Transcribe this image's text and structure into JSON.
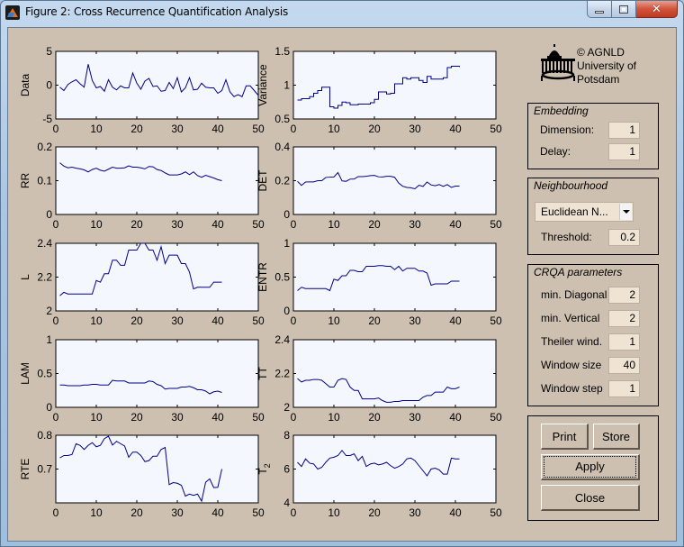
{
  "window": {
    "title": "Figure 2: Cross Recurrence Quantification Analysis",
    "controls": [
      "minimize",
      "maximize",
      "close"
    ]
  },
  "credit": {
    "line1": "© AGNLD",
    "line2": "University of",
    "line3": "Potsdam"
  },
  "embedding": {
    "title": "Embedding",
    "dimension_label": "Dimension:",
    "dimension_value": "1",
    "delay_label": "Delay:",
    "delay_value": "1"
  },
  "neighbourhood": {
    "title": "Neighbourhood",
    "norm_selected": "Euclidean N...",
    "threshold_label": "Threshold:",
    "threshold_value": "0.2"
  },
  "crqa": {
    "title": "CRQA parameters",
    "params": [
      {
        "label": "min. Diagonal",
        "value": "2"
      },
      {
        "label": "min. Vertical",
        "value": "2"
      },
      {
        "label": "Theiler wind.",
        "value": "1"
      },
      {
        "label": "Window size",
        "value": "40"
      },
      {
        "label": "Window step",
        "value": "1"
      }
    ]
  },
  "buttons": {
    "print": "Print",
    "store": "Store",
    "apply": "Apply",
    "close": "Close"
  },
  "colors": {
    "line": "#00008b",
    "axes_bg": "#f5f7fe",
    "figure_bg": "#cdc0b1"
  },
  "chart_data": [
    {
      "type": "line",
      "ylabel": "Data",
      "xlim": [
        0,
        50
      ],
      "ylim": [
        -5,
        5
      ],
      "xticks": [
        "0",
        "10",
        "20",
        "30",
        "40",
        "50"
      ],
      "yticks": [
        "-5",
        "0",
        "5"
      ],
      "ytick_values": [
        -5,
        0,
        5
      ],
      "x": [
        1,
        2,
        3,
        4,
        5,
        6,
        7,
        8,
        9,
        10,
        11,
        12,
        13,
        14,
        15,
        16,
        17,
        18,
        19,
        20,
        21,
        22,
        23,
        24,
        25,
        26,
        27,
        28,
        29,
        30,
        31,
        32,
        33,
        34,
        35,
        36,
        37,
        38,
        39,
        40,
        41,
        42,
        43,
        44,
        45,
        46,
        47,
        48,
        49,
        50
      ],
      "y": [
        -0.3,
        -0.8,
        0.1,
        0.5,
        0.8,
        0.2,
        -0.3,
        3.1,
        0.7,
        -0.4,
        -0.2,
        -0.9,
        0.8,
        -0.3,
        -0.7,
        -0.1,
        -0.4,
        -0.4,
        1.8,
        0.3,
        -0.6,
        0.6,
        1.0,
        -0.2,
        -0.1,
        -0.9,
        -0.8,
        0.4,
        -0.5,
        1.1,
        -1.0,
        -0.4,
        1.1,
        -0.7,
        -0.6,
        0.3,
        -0.3,
        -0.4,
        -0.4,
        -1.2,
        -0.8,
        0.8,
        -1.0,
        -1.7,
        -1.4,
        -1.7,
        -0.1,
        -0.1,
        -0.8,
        -1.5
      ]
    },
    {
      "type": "line",
      "step": true,
      "ylabel": "Variance",
      "xlim": [
        0,
        50
      ],
      "ylim": [
        0.5,
        1.5
      ],
      "xticks": [
        "0",
        "10",
        "20",
        "30",
        "40",
        "50"
      ],
      "yticks": [
        "0.5",
        "1",
        "1.5"
      ],
      "ytick_values": [
        0.5,
        1,
        1.5
      ],
      "x": [
        1,
        2,
        3,
        4,
        5,
        6,
        7,
        8,
        9,
        10,
        11,
        12,
        13,
        14,
        15,
        16,
        17,
        18,
        19,
        20,
        21,
        22,
        23,
        24,
        25,
        26,
        27,
        28,
        29,
        30,
        31,
        32,
        33,
        34,
        35,
        36,
        37,
        38,
        39,
        40,
        41
      ],
      "y": [
        0.78,
        0.8,
        0.8,
        0.83,
        0.88,
        0.92,
        0.97,
        0.97,
        0.68,
        0.66,
        0.7,
        0.75,
        0.74,
        0.71,
        0.71,
        0.72,
        0.72,
        0.72,
        0.74,
        0.79,
        0.9,
        0.9,
        0.87,
        0.88,
        1.02,
        1.02,
        1.11,
        1.09,
        1.11,
        1.11,
        1.07,
        1.04,
        1.13,
        1.09,
        1.09,
        1.09,
        1.11,
        1.26,
        1.28,
        1.28,
        1.27
      ]
    },
    {
      "type": "line",
      "ylabel": "RR",
      "xlim": [
        0,
        50
      ],
      "ylim": [
        0,
        0.2
      ],
      "xticks": [
        "0",
        "10",
        "20",
        "30",
        "40",
        "50"
      ],
      "yticks": [
        "0",
        "0.1",
        "0.2"
      ],
      "ytick_values": [
        0,
        0.1,
        0.2
      ],
      "x": [
        1,
        2,
        3,
        4,
        5,
        6,
        7,
        8,
        9,
        10,
        11,
        12,
        13,
        14,
        15,
        16,
        17,
        18,
        19,
        20,
        21,
        22,
        23,
        24,
        25,
        26,
        27,
        28,
        29,
        30,
        31,
        32,
        33,
        34,
        35,
        36,
        37,
        38,
        39,
        40,
        41
      ],
      "y": [
        0.153,
        0.143,
        0.138,
        0.14,
        0.137,
        0.135,
        0.132,
        0.126,
        0.133,
        0.137,
        0.131,
        0.128,
        0.134,
        0.14,
        0.137,
        0.137,
        0.138,
        0.144,
        0.14,
        0.14,
        0.138,
        0.135,
        0.142,
        0.141,
        0.133,
        0.13,
        0.123,
        0.117,
        0.117,
        0.117,
        0.12,
        0.126,
        0.118,
        0.126,
        0.115,
        0.11,
        0.116,
        0.112,
        0.108,
        0.103,
        0.1
      ]
    },
    {
      "type": "line",
      "ylabel": "DET",
      "xlim": [
        0,
        50
      ],
      "ylim": [
        0,
        0.4
      ],
      "xticks": [
        "0",
        "10",
        "20",
        "30",
        "40",
        "50"
      ],
      "yticks": [
        "0",
        "0.2",
        "0.4"
      ],
      "ytick_values": [
        0,
        0.2,
        0.4
      ],
      "x": [
        1,
        2,
        3,
        4,
        5,
        6,
        7,
        8,
        9,
        10,
        11,
        12,
        13,
        14,
        15,
        16,
        17,
        18,
        19,
        20,
        21,
        22,
        23,
        24,
        25,
        26,
        27,
        28,
        29,
        30,
        31,
        32,
        33,
        34,
        35,
        36,
        37,
        38,
        39,
        40,
        41
      ],
      "y": [
        0.196,
        0.172,
        0.192,
        0.193,
        0.193,
        0.2,
        0.2,
        0.219,
        0.221,
        0.222,
        0.248,
        0.199,
        0.196,
        0.209,
        0.21,
        0.224,
        0.224,
        0.226,
        0.23,
        0.231,
        0.223,
        0.222,
        0.226,
        0.226,
        0.22,
        0.186,
        0.167,
        0.16,
        0.158,
        0.152,
        0.173,
        0.166,
        0.192,
        0.175,
        0.17,
        0.177,
        0.166,
        0.177,
        0.16,
        0.168,
        0.168
      ]
    },
    {
      "type": "line",
      "ylabel": "L",
      "xlim": [
        0,
        50
      ],
      "ylim": [
        2,
        2.4
      ],
      "xticks": [
        "0",
        "10",
        "20",
        "30",
        "40",
        "50"
      ],
      "yticks": [
        "2",
        "2.2",
        "2.4"
      ],
      "ytick_values": [
        2,
        2.2,
        2.4
      ],
      "x": [
        1,
        2,
        3,
        4,
        5,
        6,
        7,
        8,
        9,
        10,
        11,
        12,
        13,
        14,
        15,
        16,
        17,
        18,
        19,
        20,
        21,
        22,
        23,
        24,
        25,
        26,
        27,
        28,
        29,
        30,
        31,
        32,
        33,
        34,
        35,
        36,
        37,
        38,
        39,
        40,
        41
      ],
      "y": [
        2.09,
        2.11,
        2.1,
        2.1,
        2.1,
        2.1,
        2.1,
        2.1,
        2.1,
        2.18,
        2.17,
        2.22,
        2.22,
        2.3,
        2.3,
        2.27,
        2.27,
        2.36,
        2.36,
        2.36,
        2.4,
        2.4,
        2.36,
        2.36,
        2.3,
        2.38,
        2.28,
        2.33,
        2.33,
        2.33,
        2.28,
        2.28,
        2.23,
        2.13,
        2.14,
        2.14,
        2.14,
        2.14,
        2.17,
        2.17,
        2.17
      ]
    },
    {
      "type": "line",
      "ylabel": "ENTR",
      "xlim": [
        0,
        50
      ],
      "ylim": [
        0,
        1
      ],
      "xticks": [
        "0",
        "10",
        "20",
        "30",
        "40",
        "50"
      ],
      "yticks": [
        "0",
        "0.5",
        "1"
      ],
      "ytick_values": [
        0,
        0.5,
        1
      ],
      "x": [
        1,
        2,
        3,
        4,
        5,
        6,
        7,
        8,
        9,
        10,
        11,
        12,
        13,
        14,
        15,
        16,
        17,
        18,
        19,
        20,
        21,
        22,
        23,
        24,
        25,
        26,
        27,
        28,
        29,
        30,
        31,
        32,
        33,
        34,
        35,
        36,
        37,
        38,
        39,
        40,
        41
      ],
      "y": [
        0.3,
        0.35,
        0.33,
        0.33,
        0.33,
        0.33,
        0.33,
        0.33,
        0.3,
        0.47,
        0.45,
        0.52,
        0.52,
        0.6,
        0.6,
        0.58,
        0.58,
        0.66,
        0.66,
        0.66,
        0.67,
        0.67,
        0.66,
        0.66,
        0.61,
        0.66,
        0.59,
        0.63,
        0.63,
        0.63,
        0.59,
        0.59,
        0.56,
        0.38,
        0.4,
        0.4,
        0.4,
        0.4,
        0.44,
        0.44,
        0.44
      ]
    },
    {
      "type": "line",
      "ylabel": "LAM",
      "xlim": [
        0,
        50
      ],
      "ylim": [
        0,
        1
      ],
      "xticks": [
        "0",
        "10",
        "20",
        "30",
        "40",
        "50"
      ],
      "yticks": [
        "0",
        "0.5",
        "1"
      ],
      "ytick_values": [
        0,
        0.5,
        1
      ],
      "x": [
        1,
        2,
        3,
        4,
        5,
        6,
        7,
        8,
        9,
        10,
        11,
        12,
        13,
        14,
        15,
        16,
        17,
        18,
        19,
        20,
        21,
        22,
        23,
        24,
        25,
        26,
        27,
        28,
        29,
        30,
        31,
        32,
        33,
        34,
        35,
        36,
        37,
        38,
        39,
        40,
        41
      ],
      "y": [
        0.33,
        0.33,
        0.32,
        0.32,
        0.32,
        0.32,
        0.33,
        0.33,
        0.34,
        0.34,
        0.33,
        0.33,
        0.33,
        0.4,
        0.39,
        0.39,
        0.39,
        0.36,
        0.36,
        0.36,
        0.36,
        0.36,
        0.39,
        0.38,
        0.34,
        0.32,
        0.27,
        0.28,
        0.28,
        0.28,
        0.3,
        0.3,
        0.31,
        0.29,
        0.26,
        0.26,
        0.24,
        0.2,
        0.23,
        0.24,
        0.22
      ]
    },
    {
      "type": "line",
      "ylabel": "TT",
      "xlim": [
        0,
        50
      ],
      "ylim": [
        2,
        2.4
      ],
      "xticks": [
        "0",
        "10",
        "20",
        "30",
        "40",
        "50"
      ],
      "yticks": [
        "2",
        "2.2",
        "2.4"
      ],
      "ytick_values": [
        2,
        2.2,
        2.4
      ],
      "x": [
        1,
        2,
        3,
        4,
        5,
        6,
        7,
        8,
        9,
        10,
        11,
        12,
        13,
        14,
        15,
        16,
        17,
        18,
        19,
        20,
        21,
        22,
        23,
        24,
        25,
        26,
        27,
        28,
        29,
        30,
        31,
        32,
        33,
        34,
        35,
        36,
        37,
        38,
        39,
        40,
        41
      ],
      "y": [
        2.17,
        2.15,
        2.16,
        2.16,
        2.165,
        2.165,
        2.16,
        2.14,
        2.12,
        2.12,
        2.16,
        2.17,
        2.165,
        2.12,
        2.1,
        2.1,
        2.05,
        2.05,
        2.05,
        2.05,
        2.055,
        2.04,
        2.03,
        2.03,
        2.035,
        2.035,
        2.04,
        2.04,
        2.04,
        2.04,
        2.04,
        2.06,
        2.07,
        2.07,
        2.09,
        2.09,
        2.09,
        2.12,
        2.11,
        2.11,
        2.12
      ]
    },
    {
      "type": "line",
      "ylabel": "RTE",
      "xlim": [
        0,
        50
      ],
      "ylim": [
        0.6,
        0.8
      ],
      "xticks": [
        "0",
        "10",
        "20",
        "30",
        "40",
        "50"
      ],
      "yticks": [
        "0.7",
        "0.8"
      ],
      "ytick_values": [
        0.7,
        0.8
      ],
      "x": [
        1,
        2,
        3,
        4,
        5,
        6,
        7,
        8,
        9,
        10,
        11,
        12,
        13,
        14,
        15,
        16,
        17,
        18,
        19,
        20,
        21,
        22,
        23,
        24,
        25,
        26,
        27,
        28,
        29,
        30,
        31,
        32,
        33,
        34,
        35,
        36,
        37,
        38,
        39,
        40,
        41
      ],
      "y": [
        0.733,
        0.74,
        0.74,
        0.743,
        0.775,
        0.77,
        0.758,
        0.77,
        0.778,
        0.766,
        0.77,
        0.79,
        0.797,
        0.771,
        0.782,
        0.775,
        0.768,
        0.735,
        0.75,
        0.75,
        0.74,
        0.722,
        0.725,
        0.738,
        0.738,
        0.758,
        0.764,
        0.654,
        0.66,
        0.658,
        0.652,
        0.62,
        0.626,
        0.622,
        0.626,
        0.605,
        0.661,
        0.671,
        0.645,
        0.646,
        0.7
      ]
    },
    {
      "type": "line",
      "ylabel": "T_2",
      "xlim": [
        0,
        50
      ],
      "ylim": [
        4,
        8
      ],
      "xticks": [
        "0",
        "10",
        "20",
        "30",
        "40",
        "50"
      ],
      "yticks": [
        "4",
        "6",
        "8"
      ],
      "ytick_values": [
        4,
        6,
        8
      ],
      "x": [
        1,
        2,
        3,
        4,
        5,
        6,
        7,
        8,
        9,
        10,
        11,
        12,
        13,
        14,
        15,
        16,
        17,
        18,
        19,
        20,
        21,
        22,
        23,
        24,
        25,
        26,
        27,
        28,
        29,
        30,
        31,
        32,
        33,
        34,
        35,
        36,
        37,
        38,
        39,
        40,
        41
      ],
      "y": [
        6.4,
        6.15,
        6.6,
        6.35,
        6.3,
        6.0,
        6.1,
        6.4,
        6.65,
        6.7,
        6.8,
        7.1,
        6.8,
        6.8,
        6.9,
        6.5,
        6.75,
        6.15,
        6.3,
        6.35,
        6.25,
        6.3,
        6.4,
        6.2,
        6.05,
        6.15,
        6.3,
        6.6,
        6.65,
        6.5,
        6.2,
        5.9,
        5.6,
        6.0,
        6.05,
        5.95,
        5.7,
        5.7,
        6.65,
        6.6,
        6.6
      ]
    }
  ]
}
